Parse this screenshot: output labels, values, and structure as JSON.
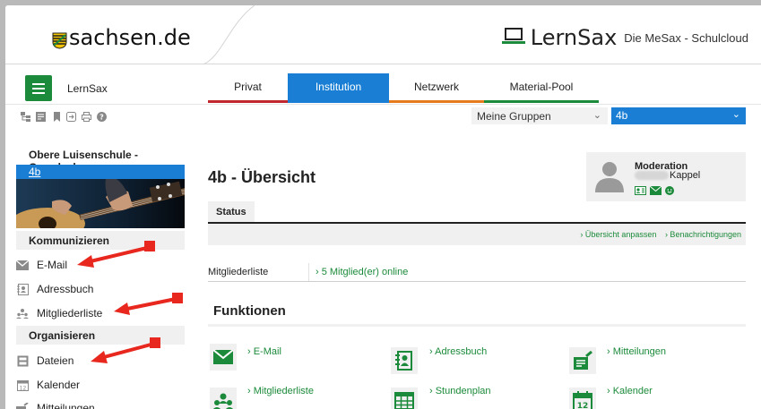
{
  "header": {
    "portal_logo_text": "sachsen.de",
    "product_name": "LernSax",
    "tagline": "Die MeSax - Schulcloud"
  },
  "nav": {
    "app_name": "LernSax",
    "tabs": [
      {
        "label": "Privat",
        "color": "#c0282d"
      },
      {
        "label": "Institution",
        "color": "#1a7fd4",
        "active": true
      },
      {
        "label": "Netzwerk",
        "color": "#e57b1d"
      },
      {
        "label": "Material-Pool",
        "color": "#1b8a3a"
      }
    ]
  },
  "toolbar": {
    "icons": [
      "tree-icon",
      "notes-icon",
      "bookmark-icon",
      "login-icon",
      "print-icon",
      "help-icon"
    ],
    "group_select": "Meine Gruppen",
    "class_select": "4b"
  },
  "sidebar": {
    "school": "Obere Luisenschule -Grundsch..",
    "class_link": "4b",
    "sections": [
      {
        "title": "Kommunizieren",
        "items": [
          "E-Mail",
          "Adressbuch",
          "Mitgliederliste"
        ]
      },
      {
        "title": "Organisieren",
        "items": [
          "Dateien",
          "Kalender",
          "Mitteilungen"
        ]
      }
    ]
  },
  "main": {
    "title": "4b - Übersicht",
    "moderator": {
      "role": "Moderation",
      "name": "Kappel"
    },
    "status_tab": "Status",
    "status_links": [
      "› Übersicht anpassen",
      "› Benachrichtigungen"
    ],
    "member_list_label": "Mitgliederliste",
    "member_list_value": "› 5 Mitglied(er) online",
    "functions_title": "Funktionen",
    "functions": [
      "› E-Mail",
      "› Adressbuch",
      "› Mitteilungen",
      "› Mitgliederliste",
      "› Stundenplan",
      "› Kalender"
    ]
  },
  "colors": {
    "accent_green": "#1b8a3a",
    "accent_blue": "#1a7fd4",
    "annotation_red": "#e8281e"
  }
}
